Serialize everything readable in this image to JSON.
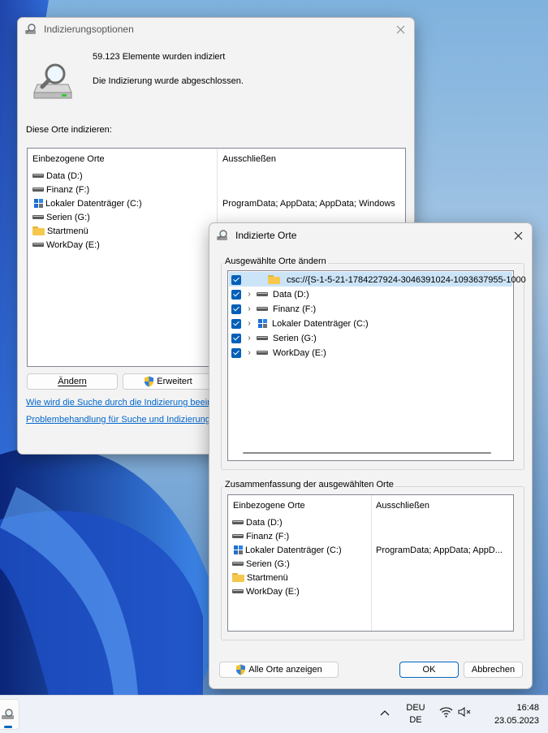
{
  "main_window": {
    "title": "Indizierungsoptionen",
    "count_text": "59.123 Elemente wurden indiziert",
    "status_text": "Die Indizierung wurde abgeschlossen.",
    "section_label": "Diese Orte indizieren:",
    "columns": [
      "Einbezogene Orte",
      "Ausschließen"
    ],
    "locations": [
      {
        "icon": "drive-icon",
        "name": "Data (D:)",
        "exclude": ""
      },
      {
        "icon": "drive-icon",
        "name": "Finanz (F:)",
        "exclude": ""
      },
      {
        "icon": "windows-drive-icon",
        "name": "Lokaler Datenträger (C:)",
        "exclude": "ProgramData; AppData; AppData; Windows"
      },
      {
        "icon": "drive-icon",
        "name": "Serien (G:)",
        "exclude": ""
      },
      {
        "icon": "folder-icon",
        "name": "Startmenü",
        "exclude": ""
      },
      {
        "icon": "drive-icon",
        "name": "WorkDay (E:)",
        "exclude": ""
      }
    ],
    "modify_button": "Ändern",
    "advanced_button": "Erweitert",
    "link_how": "Wie wird die Suche durch die Indizierung beeinf",
    "link_troubleshoot": "Problembehandlung für Suche und Indizierung"
  },
  "dialog": {
    "title": "Indizierte Orte",
    "change_group_label": "Ausgewählte Orte ändern",
    "tree": [
      {
        "name": "csc://{S-1-5-21-1784227924-3046391024-1093637955-1000",
        "icon": "folder-icon",
        "expandable": false
      },
      {
        "name": "Data (D:)",
        "icon": "drive-icon",
        "expandable": true
      },
      {
        "name": "Finanz (F:)",
        "icon": "drive-icon",
        "expandable": true
      },
      {
        "name": "Lokaler Datenträger (C:)",
        "icon": "windows-drive-icon",
        "expandable": true
      },
      {
        "name": "Serien (G:)",
        "icon": "drive-icon",
        "expandable": true
      },
      {
        "name": "WorkDay (E:)",
        "icon": "drive-icon",
        "expandable": true
      }
    ],
    "summary_group_label": "Zusammenfassung der ausgewählten Orte",
    "columns": [
      "Einbezogene Orte",
      "Ausschließen"
    ],
    "summary": [
      {
        "icon": "drive-icon",
        "name": "Data (D:)",
        "exclude": ""
      },
      {
        "icon": "drive-icon",
        "name": "Finanz (F:)",
        "exclude": ""
      },
      {
        "icon": "windows-drive-icon",
        "name": "Lokaler Datenträger (C:)",
        "exclude": "ProgramData; AppData; AppD..."
      },
      {
        "icon": "drive-icon",
        "name": "Serien (G:)",
        "exclude": ""
      },
      {
        "icon": "folder-icon",
        "name": "Startmenü",
        "exclude": ""
      },
      {
        "icon": "drive-icon",
        "name": "WorkDay (E:)",
        "exclude": ""
      }
    ],
    "show_all_button": "Alle Orte anzeigen",
    "ok_button": "OK",
    "cancel_button": "Abbrechen"
  },
  "taskbar": {
    "language_line1": "DEU",
    "language_line2": "DE",
    "time": "16:48",
    "date": "23.05.2023"
  },
  "colors": {
    "accent": "#005fb8",
    "link": "#0066cc",
    "window_bg": "#f3f3f3",
    "selected_row": "#cce4f7"
  }
}
